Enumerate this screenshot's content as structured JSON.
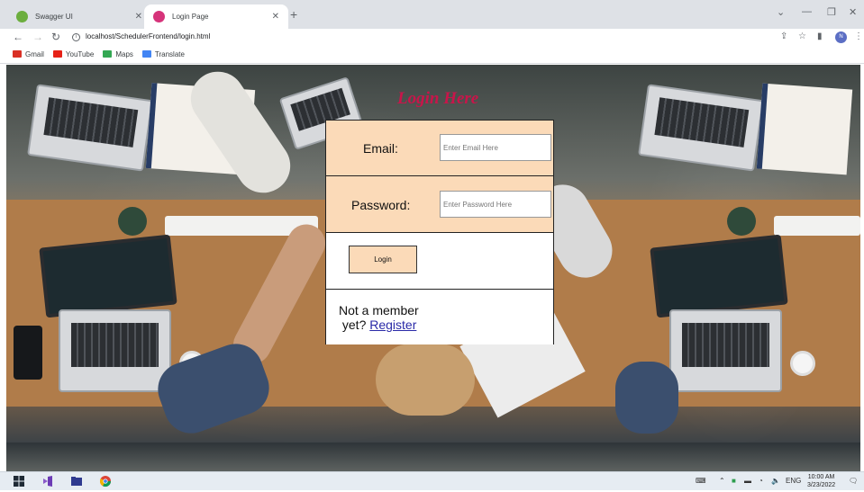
{
  "browser": {
    "tabs": [
      {
        "label": "Swagger UI",
        "active": false,
        "favicon_color": "#6cae3e"
      },
      {
        "label": "Login Page",
        "active": true,
        "favicon_color": "#d6337a"
      }
    ],
    "url": "localhost/SchedulerFrontend/login.html",
    "profile_initial": "N",
    "bookmarks": [
      {
        "label": "Gmail",
        "color": "#d93025"
      },
      {
        "label": "YouTube",
        "color": "#e62117"
      },
      {
        "label": "Maps",
        "color": "#34a853"
      },
      {
        "label": "Translate",
        "color": "#4285f4"
      }
    ]
  },
  "page": {
    "title": "Login Here",
    "email_label": "Email:",
    "email_placeholder": "Enter Email Here",
    "password_label": "Password:",
    "password_placeholder": "Enter Password Here",
    "login_button": "Login",
    "not_member_line1": "Not a member",
    "not_member_line2": "yet?",
    "register_link": "Register",
    "title_color": "#c8154a",
    "panel_color": "#fbdab8"
  },
  "taskbar": {
    "language": "ENG",
    "time": "10:00 AM",
    "date": "3/23/2022"
  }
}
